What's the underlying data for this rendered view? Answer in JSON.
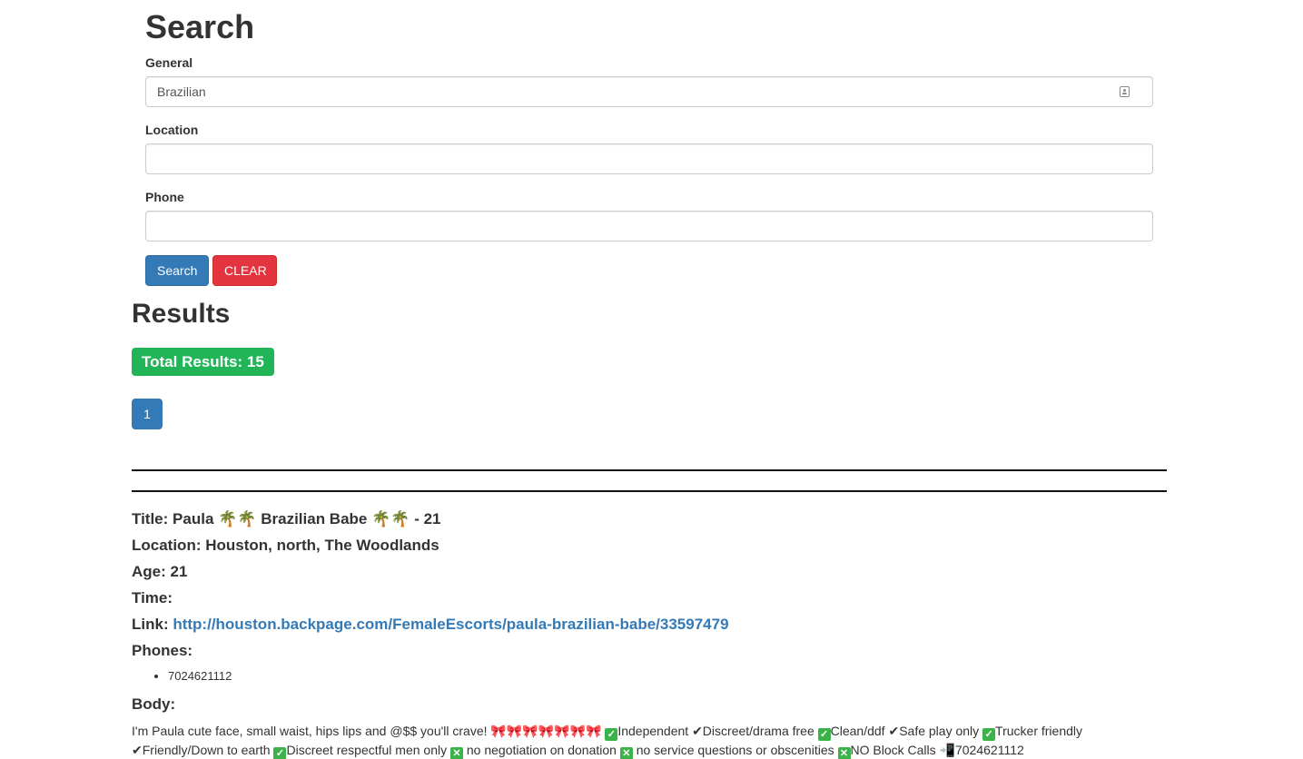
{
  "search": {
    "heading": "Search",
    "general_label": "General",
    "general_value": "Brazilian",
    "location_label": "Location",
    "location_value": "",
    "phone_label": "Phone",
    "phone_value": "",
    "search_button": "Search",
    "clear_button": "CLEAR",
    "icons": {
      "general_field_icon": "contact-card-icon"
    },
    "colors": {
      "search_button": "#337ab7",
      "clear_button": "#e3343f"
    }
  },
  "results": {
    "heading": "Results",
    "total_badge": "Total Results: 15",
    "badge_color": "#22b557",
    "pagination": [
      "1"
    ]
  },
  "listing": {
    "title_label": "Title:",
    "title_value_a": "Paula",
    "title_value_b": "Brazilian Babe",
    "title_value_c": "- 21",
    "title_emoji": "🌴🌴",
    "location_label": "Location:",
    "location_value": "Houston, north, The Woodlands",
    "age_label": "Age:",
    "age_value": "21",
    "time_label": "Time:",
    "time_value": "",
    "link_label": "Link:",
    "link_value": "http://houston.backpage.com/FemaleEscorts/paula-brazilian-babe/33597479",
    "phones_label": "Phones:",
    "phones": [
      "7024621112"
    ],
    "body_label": "Body:",
    "body": {
      "p1": "I'm Paula cute face, small waist, hips lips and @$$ you'll crave!",
      "bows": "🎀🎀🎀🎀🎀🎀🎀",
      "p2": "Independent",
      "p3": "✔Discreet/drama free",
      "p4": "Clean/ddf",
      "p5": "✔Safe play only",
      "p6": "Trucker friendly",
      "p7": "✔Friendly/Down to earth",
      "p8": "Discreet respectful men only",
      "p9": "no negotiation on donation",
      "p10": "no service questions or obscenities",
      "p11": "NO Block Calls",
      "p12": "📲7024621112"
    }
  }
}
